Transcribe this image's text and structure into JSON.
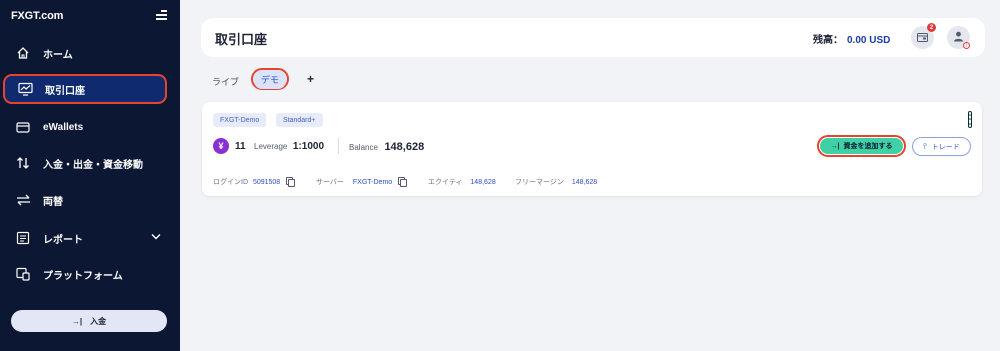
{
  "app": {
    "logo_text": "FXGT.com"
  },
  "sidebar": {
    "items": [
      {
        "label": "ホーム",
        "icon": "home-icon"
      },
      {
        "label": "取引口座",
        "icon": "chart-monitor-icon",
        "active": true
      },
      {
        "label": "eWallets",
        "icon": "wallet-icon"
      },
      {
        "label": "入金・出金・資金移動",
        "icon": "transfer-arrows-icon"
      },
      {
        "label": "両替",
        "icon": "exchange-icon"
      },
      {
        "label": "レポート",
        "icon": "report-icon"
      },
      {
        "label": "プラットフォーム",
        "icon": "platform-icon"
      }
    ],
    "deposit_button": "入金"
  },
  "header": {
    "title": "取引口座",
    "balance_label": "残高：",
    "balance_value": "0.00 USD",
    "notification_count": "2"
  },
  "tabs": {
    "live": "ライブ",
    "demo": "デモ",
    "add": "+"
  },
  "account": {
    "tags": [
      "FXGT-Demo",
      "Standard+"
    ],
    "currency_symbol": "¥",
    "id_short": "11",
    "leverage_label": "Leverage",
    "leverage_value": "1:1000",
    "balance_label": "Balance",
    "balance_value": "148,628",
    "add_funds_button": "資金を追加する",
    "trade_button": "トレード",
    "login_id_label": "ログインID",
    "login_id_value": "5091508",
    "server_label": "サーバー",
    "server_value": "FXGT-Demo",
    "equity_label": "エクイティ",
    "equity_value": "148,628",
    "free_margin_label": "フリーマージン",
    "free_margin_value": "148,628"
  },
  "colors": {
    "sidebar_bg": "#0c1733",
    "highlight_ring": "#e8432f",
    "accent_blue": "#1b3ca8",
    "add_funds_green": "#3fd1a5"
  }
}
